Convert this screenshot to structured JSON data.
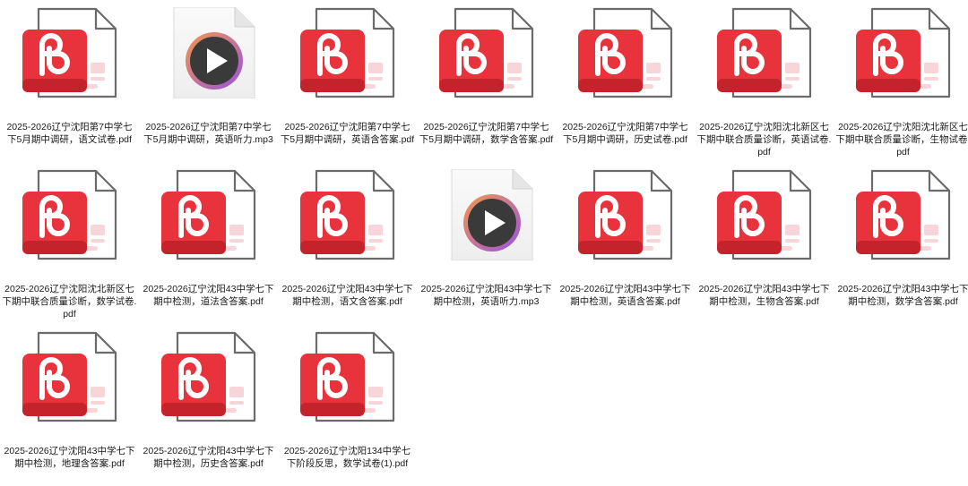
{
  "files": [
    {
      "name": "2025-2026辽宁沈阳第7中学七下5月期中调研，语文试卷.pdf",
      "type": "pdf",
      "icon": "wps-pdf-icon"
    },
    {
      "name": "2025-2026辽宁沈阳第7中学七下5月期中调研，英语听力.mp3",
      "type": "mp3",
      "icon": "media-play-icon"
    },
    {
      "name": "2025-2026辽宁沈阳第7中学七下5月期中调研，英语含答案.pdf",
      "type": "pdf",
      "icon": "wps-pdf-icon"
    },
    {
      "name": "2025-2026辽宁沈阳第7中学七下5月期中调研，数学含答案.pdf",
      "type": "pdf",
      "icon": "wps-pdf-icon"
    },
    {
      "name": "2025-2026辽宁沈阳第7中学七下5月期中调研，历史试卷.pdf",
      "type": "pdf",
      "icon": "wps-pdf-icon"
    },
    {
      "name": "2025-2026辽宁沈阳沈北新区七下期中联合质量诊断，英语试卷.pdf",
      "type": "pdf",
      "icon": "wps-pdf-icon"
    },
    {
      "name": "2025-2026辽宁沈阳沈北新区七下期中联合质量诊断，生物试卷.pdf",
      "type": "pdf",
      "icon": "wps-pdf-icon"
    },
    {
      "name": "2025-2026辽宁沈阳沈北新区七下期中联合质量诊断，数学试卷.pdf",
      "type": "pdf",
      "icon": "wps-pdf-icon"
    },
    {
      "name": "2025-2026辽宁沈阳43中学七下期中检测，道法含答案.pdf",
      "type": "pdf",
      "icon": "wps-pdf-icon"
    },
    {
      "name": "2025-2026辽宁沈阳43中学七下期中检测，语文含答案.pdf",
      "type": "pdf",
      "icon": "wps-pdf-icon"
    },
    {
      "name": "2025-2026辽宁沈阳43中学七下期中检测，英语听力.mp3",
      "type": "mp3",
      "icon": "media-play-icon"
    },
    {
      "name": "2025-2026辽宁沈阳43中学七下期中检测，英语含答案.pdf",
      "type": "pdf",
      "icon": "wps-pdf-icon"
    },
    {
      "name": "2025-2026辽宁沈阳43中学七下期中检测，生物含答案.pdf",
      "type": "pdf",
      "icon": "wps-pdf-icon"
    },
    {
      "name": "2025-2026辽宁沈阳43中学七下期中检测，数学含答案.pdf",
      "type": "pdf",
      "icon": "wps-pdf-icon"
    },
    {
      "name": "2025-2026辽宁沈阳43中学七下期中检测，地理含答案.pdf",
      "type": "pdf",
      "icon": "wps-pdf-icon"
    },
    {
      "name": "2025-2026辽宁沈阳43中学七下期中检测，历史含答案.pdf",
      "type": "pdf",
      "icon": "wps-pdf-icon"
    },
    {
      "name": "2025-2026辽宁沈阳134中学七下阶段反思，数学试卷(1).pdf",
      "type": "pdf",
      "icon": "wps-pdf-icon"
    }
  ],
  "colors": {
    "pdf_red": "#e8333d",
    "pdf_red_dark": "#c4232c",
    "page_outline": "#6b6b6b",
    "page_fill": "#ffffff",
    "accent_pink": "#f7d5d8",
    "mp3_page": "#f2f2f2",
    "play_ring_start": "#f2994a",
    "play_ring_end": "#9b51e0",
    "play_core": "#3a3a3a"
  }
}
